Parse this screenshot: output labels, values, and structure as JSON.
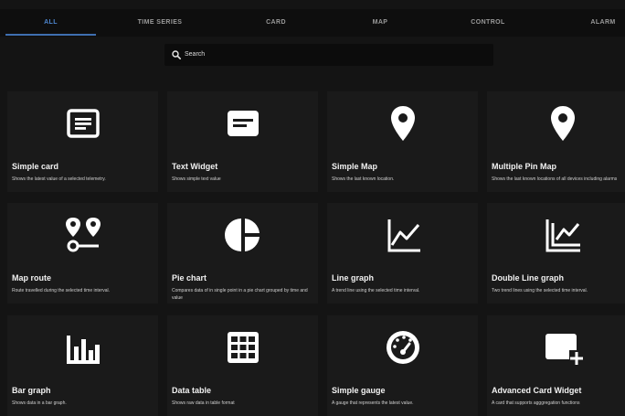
{
  "tabs": [
    {
      "label": "ALL",
      "active": true
    },
    {
      "label": "TIME SERIES"
    },
    {
      "label": "CARD"
    },
    {
      "label": "MAP"
    },
    {
      "label": "CONTROL"
    },
    {
      "label": "ALARM"
    }
  ],
  "search": {
    "placeholder": "Search",
    "icon": "search-icon"
  },
  "widgets": [
    {
      "title": "Simple card",
      "description": "Shows the latest value of a selected telemetry.",
      "icon": "card-text-icon"
    },
    {
      "title": "Text Widget",
      "description": "Shows simple text value",
      "icon": "message-icon"
    },
    {
      "title": "Simple Map",
      "description": "Shows the last known location.",
      "icon": "map-pin-icon"
    },
    {
      "title": "Multiple Pin Map",
      "description": "Shows the last known locations of all devices including alarms",
      "icon": "map-pin-icon"
    },
    {
      "title": "Map route",
      "description": "Route travelled during the selected time interval.",
      "icon": "route-icon"
    },
    {
      "title": "Pie chart",
      "description": "Compares data of in single point in a pie chart grouped by time and value",
      "icon": "pie-chart-icon"
    },
    {
      "title": "Line graph",
      "description": "A trend line using the selected time interval.",
      "icon": "line-graph-icon"
    },
    {
      "title": "Double Line graph",
      "description": "Two trend lines using the selected time interval.",
      "icon": "double-line-graph-icon"
    },
    {
      "title": "Bar graph",
      "description": "Shows data in a bar graph.",
      "icon": "bar-graph-icon"
    },
    {
      "title": "Data table",
      "description": "Shows raw data in table format",
      "icon": "table-icon"
    },
    {
      "title": "Simple gauge",
      "description": "A gauge that represents the latest value.",
      "icon": "gauge-icon"
    },
    {
      "title": "Advanced Card Widget",
      "description": "A card that supports agggregation functions",
      "icon": "card-plus-icon"
    }
  ]
}
